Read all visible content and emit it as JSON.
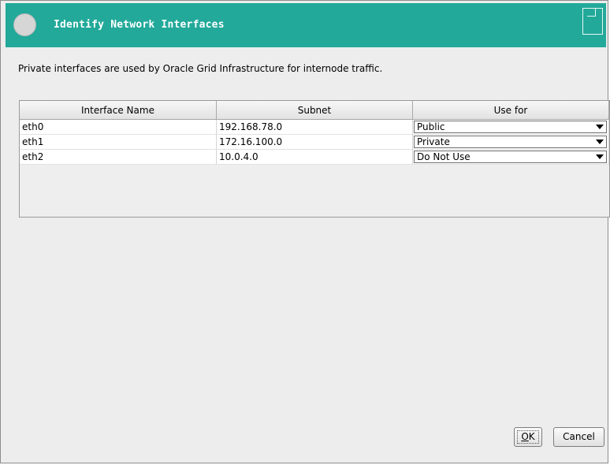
{
  "window": {
    "title": "Identify Network Interfaces"
  },
  "description": "Private interfaces are used by Oracle Grid Infrastructure for internode traffic.",
  "table": {
    "headers": [
      "Interface Name",
      "Subnet",
      "Use for"
    ],
    "rows": [
      {
        "interface": "eth0",
        "subnet": "192.168.78.0",
        "use_for": "Public"
      },
      {
        "interface": "eth1",
        "subnet": "172.16.100.0",
        "use_for": "Private"
      },
      {
        "interface": "eth2",
        "subnet": "10.0.4.0",
        "use_for": "Do Not Use"
      }
    ]
  },
  "buttons": {
    "ok_mnemonic": "O",
    "ok_rest": "K",
    "cancel": "Cancel"
  },
  "icons": {
    "app_icon": "circle-app-icon",
    "maximize": "maximize-icon",
    "dropdown": "chevron-down-icon"
  },
  "colors": {
    "titlebar": "#22a99a",
    "title_text": "#ffffff"
  }
}
